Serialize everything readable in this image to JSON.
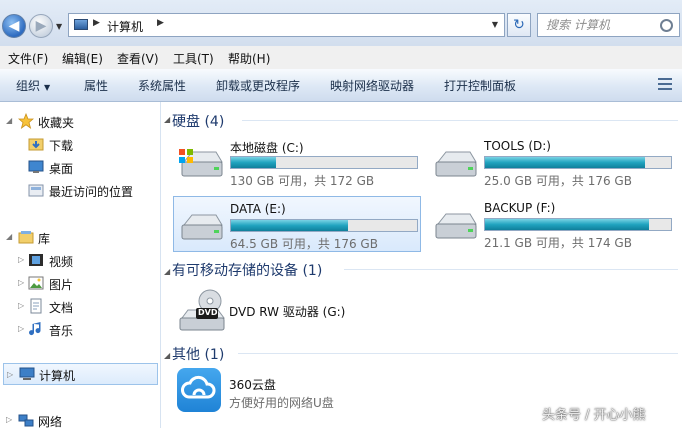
{
  "address": {
    "path": "计算机",
    "search_placeholder": "搜索 计算机"
  },
  "menu": [
    "文件(F)",
    "编辑(E)",
    "查看(V)",
    "工具(T)",
    "帮助(H)"
  ],
  "commands": [
    "组织",
    "属性",
    "系统属性",
    "卸载或更改程序",
    "映射网络驱动器",
    "打开控制面板"
  ],
  "nav": {
    "favorites": "收藏夹",
    "fav_items": [
      "下载",
      "桌面",
      "最近访问的位置"
    ],
    "libraries": "库",
    "lib_items": [
      "视频",
      "图片",
      "文档",
      "音乐"
    ],
    "computer": "计算机",
    "network": "网络"
  },
  "groups": {
    "hdd": "硬盘 (4)",
    "removable": "有可移动存储的设备 (1)",
    "other": "其他 (1)"
  },
  "drives": [
    {
      "name": "本地磁盘 (C:)",
      "size": "130 GB 可用，共 172 GB",
      "used_fraction": 0.24
    },
    {
      "name": "TOOLS (D:)",
      "size": "25.0 GB 可用，共 176 GB",
      "used_fraction": 0.86
    },
    {
      "name": "DATA (E:)",
      "size": "64.5 GB 可用，共 176 GB",
      "used_fraction": 0.63
    },
    {
      "name": "BACKUP (F:)",
      "size": "21.1 GB 可用，共 174 GB",
      "used_fraction": 0.88
    }
  ],
  "dvd": {
    "name": "DVD RW 驱动器 (G:)",
    "badge": "DVD"
  },
  "cloud": {
    "name": "360云盘",
    "desc": "方便好用的网络U盘"
  },
  "watermark": "头条号 / 开心小熊",
  "colors": {
    "accent": "#1e3a6d",
    "bar_fill": "#20a3bf"
  }
}
